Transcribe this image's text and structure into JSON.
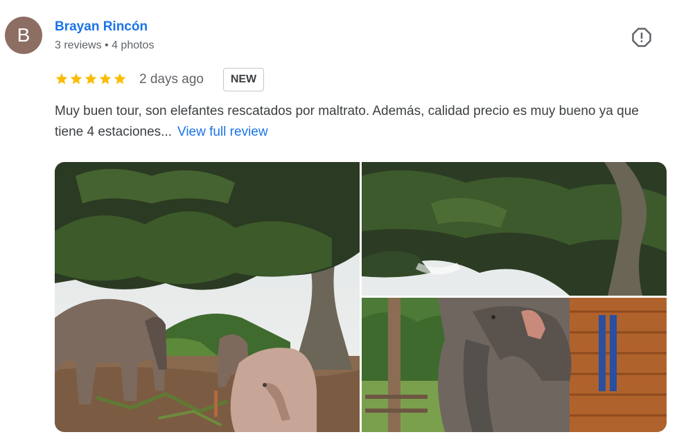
{
  "author": {
    "initial": "B",
    "name": "Brayan Rincón",
    "meta": "3 reviews • 4 photos",
    "avatar_color": "#8d6e63"
  },
  "review": {
    "rating": 5,
    "max_rating": 5,
    "date": "2 days ago",
    "badge": "NEW",
    "text": "Muy buen tour, son elefantes rescatados por maltrato. Además, calidad precio es muy bueno ya que tiene 4 estaciones...",
    "view_full_label": "View full review"
  },
  "icons": {
    "flag": "report-flag-icon",
    "star": "star-icon"
  },
  "colors": {
    "link": "#1a73e8",
    "star": "#fbbc04",
    "muted": "#5f6368"
  },
  "photos": [
    {
      "name": "review-photo-1",
      "subject": "elephants-under-tree"
    },
    {
      "name": "review-photo-2",
      "subject": "tree-canopy"
    },
    {
      "name": "review-photo-3",
      "subject": "elephant-by-wooden-house"
    }
  ]
}
